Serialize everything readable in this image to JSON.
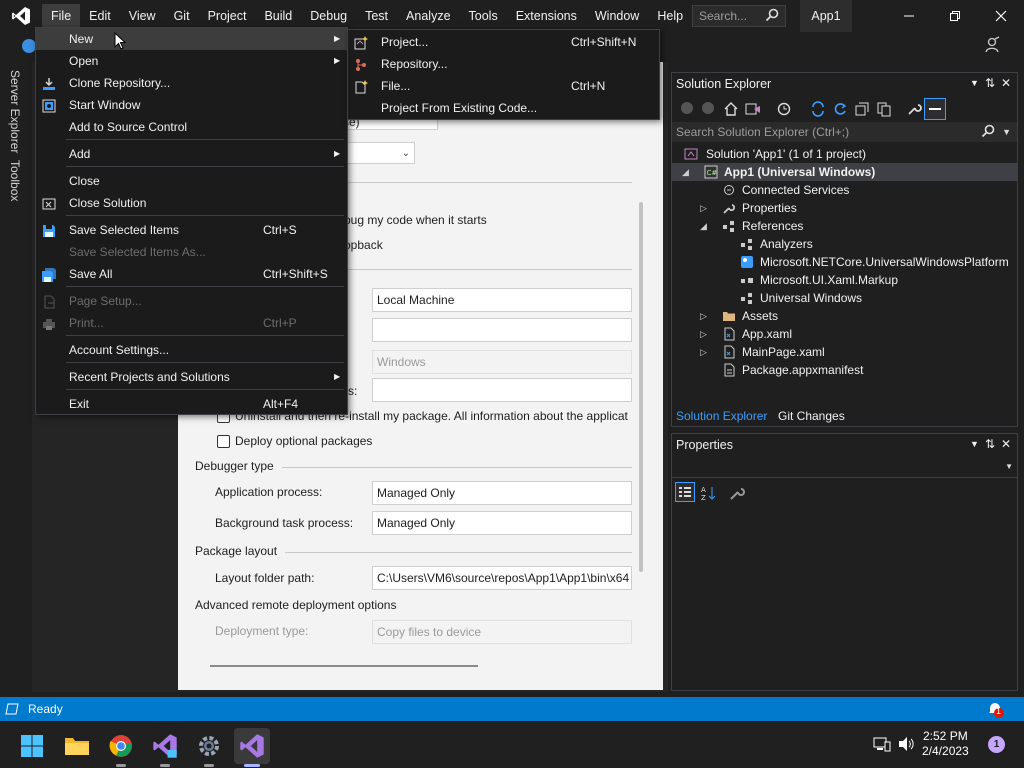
{
  "menubar": {
    "items": [
      "File",
      "Edit",
      "View",
      "Git",
      "Project",
      "Build",
      "Debug",
      "Test",
      "Analyze",
      "Tools",
      "Extensions",
      "Window",
      "Help"
    ],
    "search_placeholder": "Search...",
    "app_title": "App1"
  },
  "left_tabs": [
    "Server Explorer",
    "Toolbox"
  ],
  "file_menu": {
    "items": [
      {
        "label": "New",
        "shortcut": "",
        "submenu": true,
        "icon": ""
      },
      {
        "label": "Open",
        "shortcut": "",
        "submenu": true,
        "icon": ""
      },
      {
        "label": "Clone Repository...",
        "shortcut": "",
        "icon": "clone-icon"
      },
      {
        "label": "Start Window",
        "shortcut": "",
        "icon": "start-window-icon"
      },
      {
        "label": "Add to Source Control",
        "shortcut": ""
      },
      {
        "label": "Add",
        "shortcut": "",
        "submenu": true
      },
      {
        "label": "Close",
        "shortcut": ""
      },
      {
        "label": "Close Solution",
        "shortcut": "",
        "icon": "close-solution-icon"
      },
      {
        "label": "Save Selected Items",
        "shortcut": "Ctrl+S",
        "icon": "save-icon"
      },
      {
        "label": "Save Selected Items As...",
        "shortcut": "",
        "disabled": true
      },
      {
        "label": "Save All",
        "shortcut": "Ctrl+Shift+S",
        "icon": "save-all-icon"
      },
      {
        "label": "Page Setup...",
        "shortcut": "",
        "disabled": true,
        "icon": "page-setup-icon"
      },
      {
        "label": "Print...",
        "shortcut": "Ctrl+P",
        "disabled": true,
        "icon": "print-icon"
      },
      {
        "label": "Account Settings...",
        "shortcut": ""
      },
      {
        "label": "Recent Projects and Solutions",
        "shortcut": "",
        "submenu": true
      },
      {
        "label": "Exit",
        "shortcut": "Alt+F4"
      }
    ]
  },
  "new_submenu": {
    "items": [
      {
        "label": "Project...",
        "shortcut": "Ctrl+Shift+N",
        "icon": "new-project-icon"
      },
      {
        "label": "Repository...",
        "shortcut": "",
        "icon": "repository-icon"
      },
      {
        "label": "File...",
        "shortcut": "Ctrl+N",
        "icon": "new-file-icon"
      },
      {
        "label": "Project From Existing Code...",
        "shortcut": ""
      }
    ]
  },
  "property_page": {
    "partial_dropdown_text": "se)",
    "start_option_1": "bug my code when it starts",
    "start_option_2": "opback",
    "target_device_value": "Local Machine",
    "platform_value": "Windows",
    "partial_label": "s:",
    "uninstall_text": "Uninstall and then re-install my package. All information about the applicat",
    "deploy_optional": "Deploy optional packages",
    "debugger_type_heading": "Debugger type",
    "app_process_label": "Application process:",
    "app_process_value": "Managed Only",
    "bg_process_label": "Background task process:",
    "bg_process_value": "Managed Only",
    "package_layout_heading": "Package layout",
    "layout_folder_label": "Layout folder path:",
    "layout_folder_value": "C:\\Users\\VM6\\source\\repos\\App1\\App1\\bin\\x64",
    "adv_remote_heading": "Advanced remote deployment options",
    "deployment_type_label": "Deployment type:",
    "deployment_type_value": "Copy files to device"
  },
  "solution_explorer": {
    "title": "Solution Explorer",
    "search_placeholder": "Search Solution Explorer (Ctrl+;)",
    "tree": [
      {
        "label": "Solution 'App1' (1 of 1 project)",
        "level": 0,
        "arrow": ""
      },
      {
        "label": "App1 (Universal Windows)",
        "level": 0,
        "arrow": "expanded",
        "bold": true
      },
      {
        "label": "Connected Services",
        "level": 1,
        "arrow": ""
      },
      {
        "label": "Properties",
        "level": 1,
        "arrow": "collapsed"
      },
      {
        "label": "References",
        "level": 1,
        "arrow": "expanded"
      },
      {
        "label": "Analyzers",
        "level": 2,
        "arrow": ""
      },
      {
        "label": "Microsoft.NETCore.UniversalWindowsPlatform",
        "level": 2,
        "arrow": ""
      },
      {
        "label": "Microsoft.UI.Xaml.Markup",
        "level": 2,
        "arrow": ""
      },
      {
        "label": "Universal Windows",
        "level": 2,
        "arrow": ""
      },
      {
        "label": "Assets",
        "level": 1,
        "arrow": "collapsed"
      },
      {
        "label": "App.xaml",
        "level": 1,
        "arrow": "collapsed"
      },
      {
        "label": "MainPage.xaml",
        "level": 1,
        "arrow": "collapsed"
      },
      {
        "label": "Package.appxmanifest",
        "level": 1,
        "arrow": ""
      }
    ],
    "tabs": [
      "Solution Explorer",
      "Git Changes"
    ]
  },
  "properties_panel": {
    "title": "Properties"
  },
  "statusbar": {
    "status": "Ready",
    "notification_count": "1"
  },
  "taskbar": {
    "time": "2:52 PM",
    "date": "2/4/2023",
    "notification_badge": "1"
  },
  "colors": {
    "accent": "#007acc",
    "vs_purple": "#a879e6"
  }
}
